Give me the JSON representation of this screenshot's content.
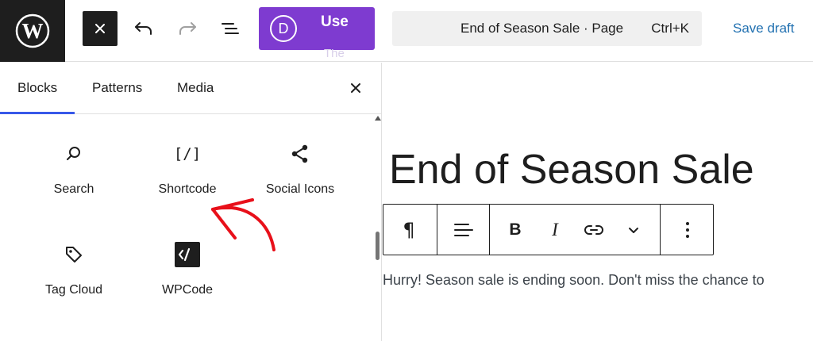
{
  "topbar": {
    "logo_icon": "wordpress-logo-icon",
    "close_icon": "close-icon",
    "undo_icon": "undo-icon",
    "redo_icon": "redo-icon",
    "list_view_icon": "list-view-icon",
    "divi": {
      "letter": "D",
      "label": "Use",
      "label_overflow": "The"
    },
    "document": {
      "title": "End of Season Sale · Page",
      "shortcut": "Ctrl+K"
    },
    "save_draft": "Save draft"
  },
  "inserter": {
    "tabs": [
      {
        "label": "Blocks",
        "active": true
      },
      {
        "label": "Patterns",
        "active": false
      },
      {
        "label": "Media",
        "active": false
      }
    ],
    "close_icon": "close-icon",
    "blocks": [
      {
        "label": "Search",
        "icon": "search-icon"
      },
      {
        "label": "Shortcode",
        "icon": "shortcode-icon",
        "glyph": "[/]"
      },
      {
        "label": "Social Icons",
        "icon": "share-icon"
      },
      {
        "label": "Tag Cloud",
        "icon": "tag-icon"
      },
      {
        "label": "WPCode",
        "icon": "wpcode-icon"
      }
    ],
    "annotation_color": "#e8101a"
  },
  "canvas": {
    "title": "End of Season Sale",
    "paragraph": "Hurry! Season sale is ending soon. Don't miss the chance to",
    "toolbar": {
      "paragraph_icon": "¶",
      "align_icon": "align-left-icon",
      "bold": "B",
      "italic": "I",
      "link_icon": "link-icon",
      "more_icon": "chevron-down-icon",
      "options_icon": "more-vertical-icon"
    }
  },
  "colors": {
    "accent": "#3858e9",
    "divi_purple": "#7e3bd0",
    "link": "#2271b1",
    "dark": "#1e1e1e"
  }
}
